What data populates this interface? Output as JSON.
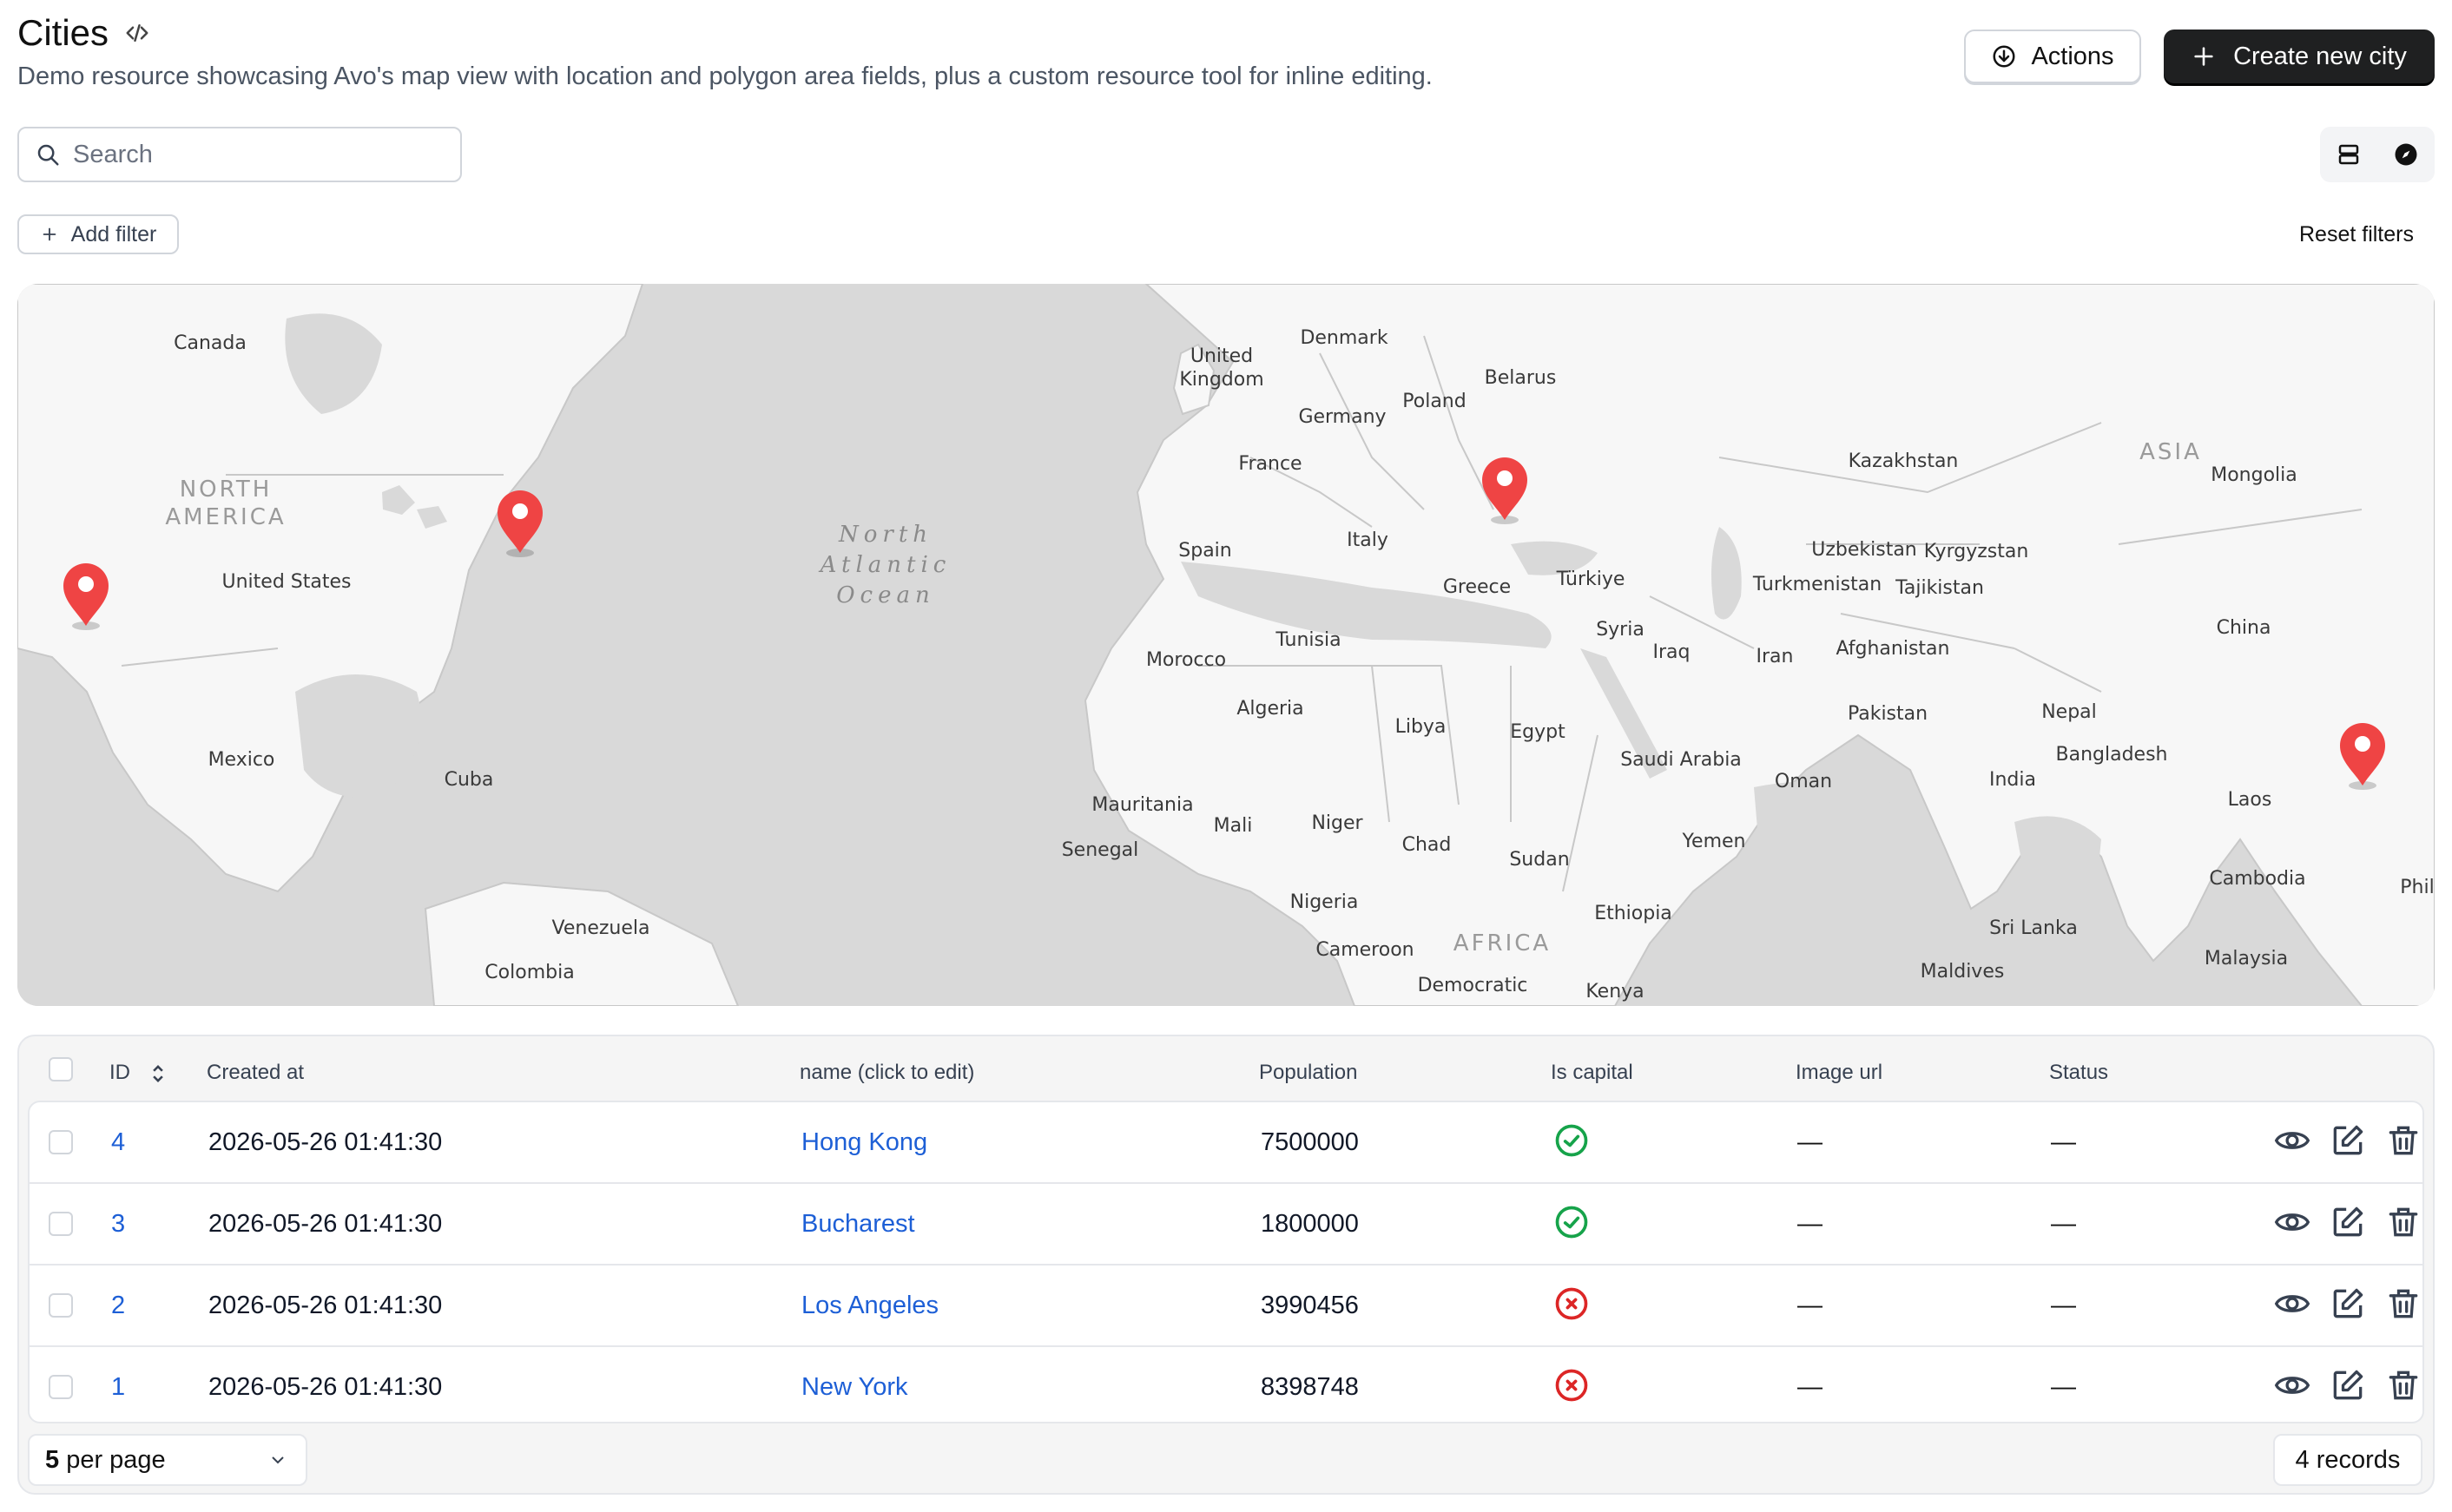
{
  "header": {
    "title": "Cities",
    "title_icon": "code-icon",
    "description": "Demo resource showcasing Avo's map view with location and polygon area fields, plus a custom resource tool for inline editing.",
    "actions_label": "Actions",
    "create_label": "Create new city"
  },
  "search": {
    "placeholder": "Search"
  },
  "filters": {
    "add_label": "Add filter",
    "reset_label": "Reset filters"
  },
  "view_toggle": {
    "options": [
      "table-view-icon",
      "map-view-icon"
    ]
  },
  "map": {
    "region_labels": [
      "NORTH",
      "AMERICA",
      "ASIA",
      "AFRICA"
    ],
    "ocean_label_lines": [
      "North",
      "Atlantic",
      "Ocean"
    ],
    "country_labels": {
      "canada": "Canada",
      "united_states": "United States",
      "mexico": "Mexico",
      "cuba": "Cuba",
      "venezuela": "Venezuela",
      "colombia": "Colombia",
      "denmark": "Denmark",
      "united_kingdom_1": "United",
      "united_kingdom_2": "Kingdom",
      "belarus": "Belarus",
      "poland": "Poland",
      "germany": "Germany",
      "france": "France",
      "spain": "Spain",
      "italy": "Italy",
      "greece": "Greece",
      "turkiye": "Türkiye",
      "syria": "Syria",
      "iraq": "Iraq",
      "iran": "Iran",
      "tunisia": "Tunisia",
      "morocco": "Morocco",
      "algeria": "Algeria",
      "libya": "Libya",
      "egypt": "Egypt",
      "mauritania": "Mauritania",
      "mali": "Mali",
      "niger": "Niger",
      "chad": "Chad",
      "sudan": "Sudan",
      "senegal": "Senegal",
      "nigeria": "Nigeria",
      "cameroon": "Cameroon",
      "democratic": "Democratic",
      "ethiopia": "Ethiopia",
      "kenya": "Kenya",
      "yemen": "Yemen",
      "oman": "Oman",
      "saudi_arabia": "Saudi Arabia",
      "kazakhstan": "Kazakhstan",
      "uzbekistan": "Uzbekistan",
      "kyrgyzstan": "Kyrgyzstan",
      "turkmenistan": "Turkmenistan",
      "tajikistan": "Tajikistan",
      "afghanistan": "Afghanistan",
      "pakistan": "Pakistan",
      "nepal": "Nepal",
      "india": "India",
      "bangladesh": "Bangladesh",
      "sri_lanka": "Sri Lanka",
      "maldives": "Maldives",
      "mongolia": "Mongolia",
      "china": "China",
      "laos": "Laos",
      "cambodia": "Cambodia",
      "malaysia": "Malaysia",
      "phil": "Phil"
    },
    "marker_icon": "map-pin-icon",
    "marker_color": "#ef4444"
  },
  "table": {
    "columns": [
      "ID",
      "Created at",
      "name (click to edit)",
      "Population",
      "Is capital",
      "Image url",
      "Status"
    ],
    "rows": [
      {
        "id": "4",
        "created_at": "2026-05-26 01:41:30",
        "name": "Hong Kong",
        "population": "7500000",
        "is_capital": "yes",
        "image_url": "—",
        "status": "—"
      },
      {
        "id": "3",
        "created_at": "2026-05-26 01:41:30",
        "name": "Bucharest",
        "population": "1800000",
        "is_capital": "yes",
        "image_url": "—",
        "status": "—"
      },
      {
        "id": "2",
        "created_at": "2026-05-26 01:41:30",
        "name": "Los Angeles",
        "population": "3990456",
        "is_capital": "no",
        "image_url": "—",
        "status": "—"
      },
      {
        "id": "1",
        "created_at": "2026-05-26 01:41:30",
        "name": "New York",
        "population": "8398748",
        "is_capital": "no",
        "image_url": "—",
        "status": "—"
      }
    ],
    "row_actions": [
      "view-icon",
      "edit-icon",
      "delete-icon"
    ],
    "colors": {
      "link": "#1d5fd6",
      "capital_yes": "#16a34a",
      "capital_no": "#dc2626"
    }
  },
  "pagination": {
    "per_page_value": "5",
    "per_page_suffix": " per page",
    "records": "4 records"
  }
}
